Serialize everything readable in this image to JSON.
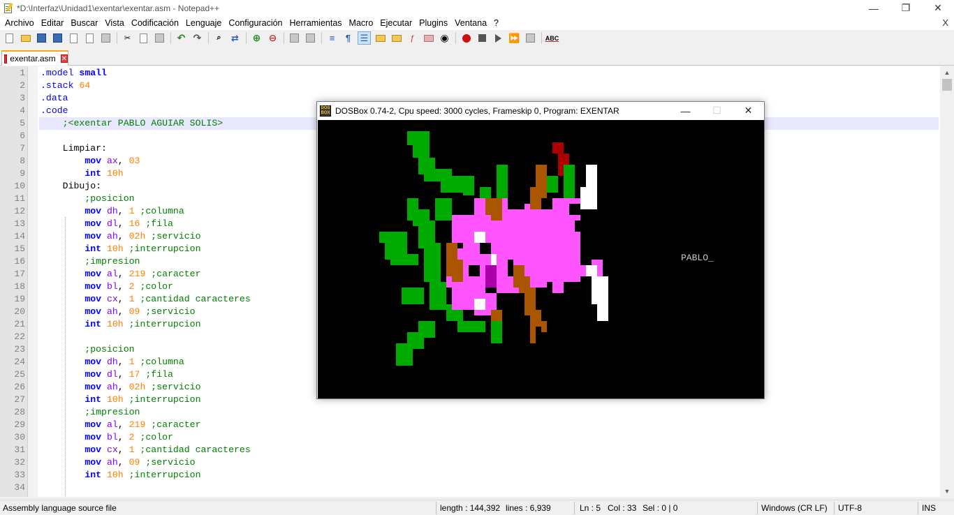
{
  "window": {
    "title": "*D:\\Interfaz\\Unidad1\\exentar\\exentar.asm - Notepad++",
    "minimize": "—",
    "restore": "❐",
    "close": "✕"
  },
  "menu": {
    "items": [
      {
        "label": "Archivo"
      },
      {
        "label": "Editar"
      },
      {
        "label": "Buscar"
      },
      {
        "label": "Vista"
      },
      {
        "label": "Codificación"
      },
      {
        "label": "Lenguaje"
      },
      {
        "label": "Configuración"
      },
      {
        "label": "Herramientas"
      },
      {
        "label": "Macro"
      },
      {
        "label": "Ejecutar"
      },
      {
        "label": "Plugins"
      },
      {
        "label": "Ventana"
      },
      {
        "label": "?"
      }
    ],
    "close": "X"
  },
  "toolbar": {
    "spellcheck_label": "ABC"
  },
  "tab": {
    "label": "exentar.asm",
    "close": "✕"
  },
  "editor": {
    "current_line": 5,
    "lines": [
      {
        "n": "1",
        "tokens": [
          [
            "dir",
            ".model "
          ],
          [
            "ins",
            "small"
          ]
        ]
      },
      {
        "n": "2",
        "tokens": [
          [
            "dir",
            ".stack "
          ],
          [
            "num",
            "64"
          ]
        ]
      },
      {
        "n": "3",
        "tokens": [
          [
            "dir",
            ".data"
          ]
        ]
      },
      {
        "n": "4",
        "tokens": [
          [
            "dir",
            ".code"
          ]
        ]
      },
      {
        "n": "5",
        "tokens": [
          [
            "com",
            "    ;<exentar PABLO AGUIAR SOLIS>"
          ]
        ]
      },
      {
        "n": "6",
        "tokens": []
      },
      {
        "n": "7",
        "tokens": [
          [
            "lab",
            "    Limpiar:"
          ]
        ]
      },
      {
        "n": "8",
        "tokens": [
          [
            "txt",
            "        "
          ],
          [
            "ins",
            "mov "
          ],
          [
            "reg",
            "ax"
          ],
          [
            "txt",
            ", "
          ],
          [
            "num",
            "03"
          ]
        ]
      },
      {
        "n": "9",
        "tokens": [
          [
            "txt",
            "        "
          ],
          [
            "ins",
            "int "
          ],
          [
            "num",
            "10h"
          ]
        ]
      },
      {
        "n": "10",
        "tokens": [
          [
            "lab",
            "    Dibujo:"
          ]
        ]
      },
      {
        "n": "11",
        "tokens": [
          [
            "com",
            "        ;posicion"
          ]
        ]
      },
      {
        "n": "12",
        "tokens": [
          [
            "txt",
            "        "
          ],
          [
            "ins",
            "mov "
          ],
          [
            "reg",
            "dh"
          ],
          [
            "txt",
            ", "
          ],
          [
            "num",
            "1 "
          ],
          [
            "com",
            ";columna"
          ]
        ]
      },
      {
        "n": "13",
        "tokens": [
          [
            "txt",
            "        "
          ],
          [
            "ins",
            "mov "
          ],
          [
            "reg",
            "dl"
          ],
          [
            "txt",
            ", "
          ],
          [
            "num",
            "16 "
          ],
          [
            "com",
            ";fila"
          ]
        ]
      },
      {
        "n": "14",
        "tokens": [
          [
            "txt",
            "        "
          ],
          [
            "ins",
            "mov "
          ],
          [
            "reg",
            "ah"
          ],
          [
            "txt",
            ", "
          ],
          [
            "num",
            "02h "
          ],
          [
            "com",
            ";servicio"
          ]
        ]
      },
      {
        "n": "15",
        "tokens": [
          [
            "txt",
            "        "
          ],
          [
            "ins",
            "int "
          ],
          [
            "num",
            "10h "
          ],
          [
            "com",
            ";interrupcion"
          ]
        ]
      },
      {
        "n": "16",
        "tokens": [
          [
            "com",
            "        ;impresion"
          ]
        ]
      },
      {
        "n": "17",
        "tokens": [
          [
            "txt",
            "        "
          ],
          [
            "ins",
            "mov "
          ],
          [
            "reg",
            "al"
          ],
          [
            "txt",
            ", "
          ],
          [
            "num",
            "219 "
          ],
          [
            "com",
            ";caracter"
          ]
        ]
      },
      {
        "n": "18",
        "tokens": [
          [
            "txt",
            "        "
          ],
          [
            "ins",
            "mov "
          ],
          [
            "reg",
            "bl"
          ],
          [
            "txt",
            ", "
          ],
          [
            "num",
            "2 "
          ],
          [
            "com",
            ";color"
          ]
        ]
      },
      {
        "n": "19",
        "tokens": [
          [
            "txt",
            "        "
          ],
          [
            "ins",
            "mov "
          ],
          [
            "reg",
            "cx"
          ],
          [
            "txt",
            ", "
          ],
          [
            "num",
            "1 "
          ],
          [
            "com",
            ";cantidad caracteres"
          ]
        ]
      },
      {
        "n": "20",
        "tokens": [
          [
            "txt",
            "        "
          ],
          [
            "ins",
            "mov "
          ],
          [
            "reg",
            "ah"
          ],
          [
            "txt",
            ", "
          ],
          [
            "num",
            "09 "
          ],
          [
            "com",
            ";servicio"
          ]
        ]
      },
      {
        "n": "21",
        "tokens": [
          [
            "txt",
            "        "
          ],
          [
            "ins",
            "int "
          ],
          [
            "num",
            "10h "
          ],
          [
            "com",
            ";interrupcion"
          ]
        ]
      },
      {
        "n": "22",
        "tokens": []
      },
      {
        "n": "23",
        "tokens": [
          [
            "com",
            "        ;posicion"
          ]
        ]
      },
      {
        "n": "24",
        "tokens": [
          [
            "txt",
            "        "
          ],
          [
            "ins",
            "mov "
          ],
          [
            "reg",
            "dh"
          ],
          [
            "txt",
            ", "
          ],
          [
            "num",
            "1 "
          ],
          [
            "com",
            ";columna"
          ]
        ]
      },
      {
        "n": "25",
        "tokens": [
          [
            "txt",
            "        "
          ],
          [
            "ins",
            "mov "
          ],
          [
            "reg",
            "dl"
          ],
          [
            "txt",
            ", "
          ],
          [
            "num",
            "17 "
          ],
          [
            "com",
            ";fila"
          ]
        ]
      },
      {
        "n": "26",
        "tokens": [
          [
            "txt",
            "        "
          ],
          [
            "ins",
            "mov "
          ],
          [
            "reg",
            "ah"
          ],
          [
            "txt",
            ", "
          ],
          [
            "num",
            "02h "
          ],
          [
            "com",
            ";servicio"
          ]
        ]
      },
      {
        "n": "27",
        "tokens": [
          [
            "txt",
            "        "
          ],
          [
            "ins",
            "int "
          ],
          [
            "num",
            "10h "
          ],
          [
            "com",
            ";interrupcion"
          ]
        ]
      },
      {
        "n": "28",
        "tokens": [
          [
            "com",
            "        ;impresion"
          ]
        ]
      },
      {
        "n": "29",
        "tokens": [
          [
            "txt",
            "        "
          ],
          [
            "ins",
            "mov "
          ],
          [
            "reg",
            "al"
          ],
          [
            "txt",
            ", "
          ],
          [
            "num",
            "219 "
          ],
          [
            "com",
            ";caracter"
          ]
        ]
      },
      {
        "n": "30",
        "tokens": [
          [
            "txt",
            "        "
          ],
          [
            "ins",
            "mov "
          ],
          [
            "reg",
            "bl"
          ],
          [
            "txt",
            ", "
          ],
          [
            "num",
            "2 "
          ],
          [
            "com",
            ";color"
          ]
        ]
      },
      {
        "n": "31",
        "tokens": [
          [
            "txt",
            "        "
          ],
          [
            "ins",
            "mov "
          ],
          [
            "reg",
            "cx"
          ],
          [
            "txt",
            ", "
          ],
          [
            "num",
            "1 "
          ],
          [
            "com",
            ";cantidad caracteres"
          ]
        ]
      },
      {
        "n": "32",
        "tokens": [
          [
            "txt",
            "        "
          ],
          [
            "ins",
            "mov "
          ],
          [
            "reg",
            "ah"
          ],
          [
            "txt",
            ", "
          ],
          [
            "num",
            "09 "
          ],
          [
            "com",
            ";servicio"
          ]
        ]
      },
      {
        "n": "33",
        "tokens": [
          [
            "txt",
            "        "
          ],
          [
            "ins",
            "int "
          ],
          [
            "num",
            "10h "
          ],
          [
            "com",
            ";interrupcion"
          ]
        ]
      },
      {
        "n": "34",
        "tokens": []
      }
    ]
  },
  "status": {
    "file_type": "Assembly language source file",
    "length": "length : 144,392",
    "lines": "lines : 6,939",
    "ln": "Ln : 5",
    "col": "Col : 33",
    "sel": "Sel : 0 | 0",
    "eol": "Windows (CR LF)",
    "encoding": "UTF-8",
    "mode": "INS"
  },
  "dosbox": {
    "title": "DOSBox 0.74-2, Cpu speed:     3000 cycles, Frameskip  0, Program:  EXENTAR",
    "icon_text": "DOS BOX",
    "minimize": "—",
    "maximize": "☐",
    "close": "✕",
    "screen_text": "PABLO_",
    "colors": {
      "green": "#00aa00",
      "magenta": "#ff55ff",
      "dark_magenta": "#aa00aa",
      "brown": "#aa5500",
      "white": "#ffffff",
      "red": "#aa0000",
      "black": "#000000"
    }
  }
}
